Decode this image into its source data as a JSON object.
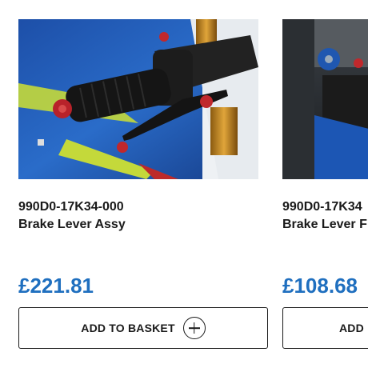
{
  "products": [
    {
      "sku": "990D0-17K34-000",
      "name": "Brake Lever Assy",
      "price": "£221.81",
      "button_label": "ADD TO BASKET",
      "image_icon": "brake-lever-photo"
    },
    {
      "sku": "990D0-17K34",
      "name": "Brake Lever F",
      "price": "£108.68",
      "button_label": "ADD",
      "image_icon": "clutch-lever-photo"
    }
  ],
  "colors": {
    "price": "#1f6fbf",
    "text": "#1a1a1a",
    "border": "#1a1a1a"
  }
}
